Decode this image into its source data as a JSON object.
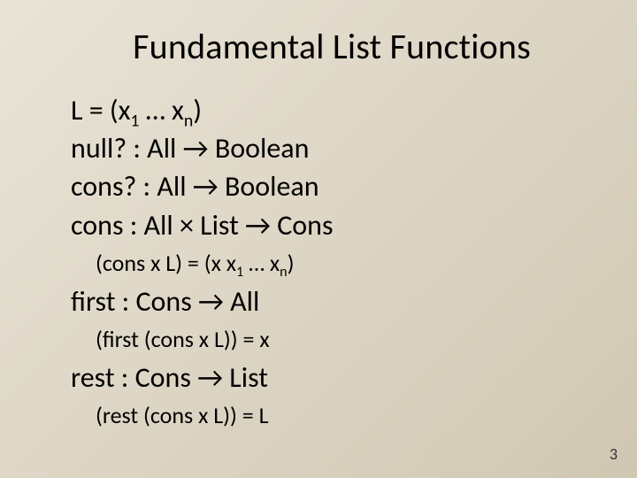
{
  "title": "Fundamental List Functions",
  "lines": {
    "l_def_pre": "L = (x",
    "l_def_sub1": "1",
    "l_def_mid": " … x",
    "l_def_subn": "n",
    "l_def_post": ")",
    "null_sig": "null? : All → Boolean",
    "consq_sig": "cons? : All → Boolean",
    "cons_sig": "cons : All × List → Cons",
    "cons_eq_pre": "(cons x L) = (x x",
    "cons_eq_sub1": "1",
    "cons_eq_mid": " … x",
    "cons_eq_subn": "n",
    "cons_eq_post": ")",
    "first_sig": "first : Cons → All",
    "first_eq": "(first (cons x L)) = x",
    "rest_sig": "rest : Cons → List",
    "rest_eq": "(rest (cons x L)) = L"
  },
  "page_number": "3"
}
